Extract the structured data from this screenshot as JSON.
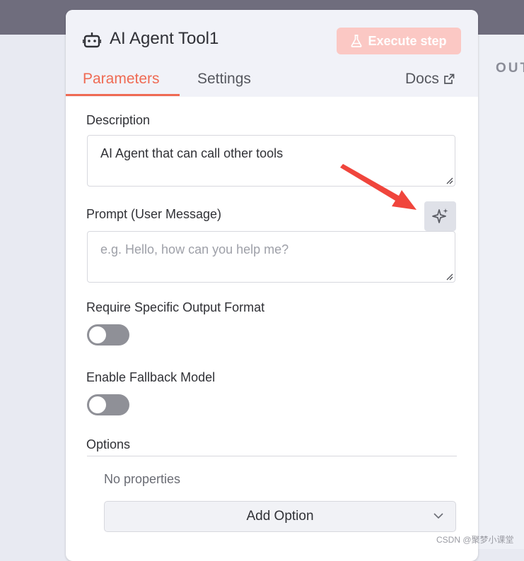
{
  "node": {
    "title": "AI Agent Tool1",
    "execute_label": "Execute step"
  },
  "tabs": {
    "parameters": "Parameters",
    "settings": "Settings",
    "docs": "Docs"
  },
  "side": {
    "output_label": "OUT"
  },
  "fields": {
    "description": {
      "label": "Description",
      "value": "AI Agent that can call other tools"
    },
    "prompt": {
      "label": "Prompt (User Message)",
      "placeholder": "e.g. Hello, how can you help me?"
    },
    "require_output_format": {
      "label": "Require Specific Output Format",
      "enabled": false
    },
    "fallback_model": {
      "label": "Enable Fallback Model",
      "enabled": false
    },
    "options": {
      "label": "Options",
      "empty_text": "No properties",
      "add_label": "Add Option"
    }
  },
  "icons": {
    "header": "robot-icon",
    "execute": "flask-icon",
    "docs": "external-link-icon",
    "ai_assist": "sparkles-icon",
    "add_option": "chevron-down-icon"
  },
  "colors": {
    "accent": "#ef6a53",
    "execute_disabled": "#fbc8c4",
    "annotation_arrow": "#f0453c",
    "toggle_off": "#8f9097"
  },
  "watermark": "CSDN @聚梦小课堂"
}
